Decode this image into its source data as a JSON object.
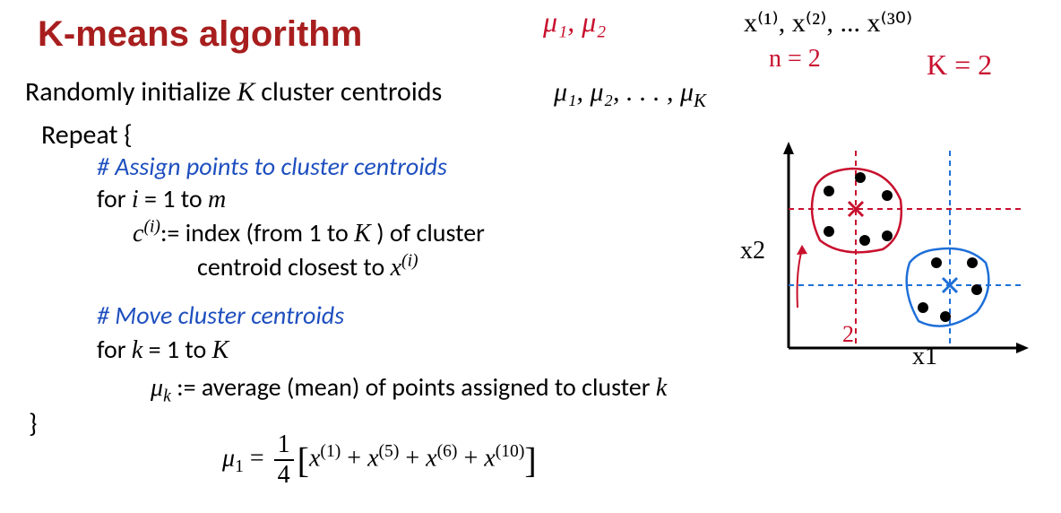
{
  "title": "K-means algorithm",
  "line1_prefix": "Randomly initialize ",
  "line1_K": "K",
  "line1_suffix": " cluster centroids",
  "mu_list": "μ₁, μ₂, . . . , μ",
  "mu_list_sub": "K",
  "repeat": "Repeat {",
  "comment1": "# Assign points to cluster centroids",
  "for1_prefix": "for ",
  "for1_i": "i",
  "for1_mid": " = 1 to ",
  "for1_m": "m",
  "ci_c": "c",
  "ci_sup": "(i)",
  "ci_text": ":= index (from 1 to ",
  "ci_K": "K",
  "ci_text2": " ) of cluster",
  "ci_line2_text": "centroid closest to ",
  "ci_line2_x": "x",
  "ci_line2_sup": "(i)",
  "comment2": "# Move cluster centroids",
  "for2_prefix": "for ",
  "for2_k": "k",
  "for2_mid": " = 1 to ",
  "for2_K": "K",
  "muk_mu": "μ",
  "muk_sub": "k",
  "muk_text": " := average (mean) of points assigned to cluster ",
  "muk_k": "k",
  "closebrace": "}",
  "formula": {
    "mu": "μ",
    "sub1": "1",
    "eq": " = ",
    "num": "1",
    "den": "4",
    "lb": "[",
    "x": "x",
    "s1": "(1)",
    "plus": " + ",
    "s5": "(5)",
    "s6": "(6)",
    "s10": "(10)",
    "rb": "]"
  },
  "hw": {
    "mu": "μ₁, μ₂",
    "x_points": "x⁽¹⁾, x⁽²⁾, ... x⁽³⁰⁾",
    "n": "n = 2",
    "K": "K = 2",
    "two": "2",
    "x1": "x1",
    "x2": "x2"
  }
}
